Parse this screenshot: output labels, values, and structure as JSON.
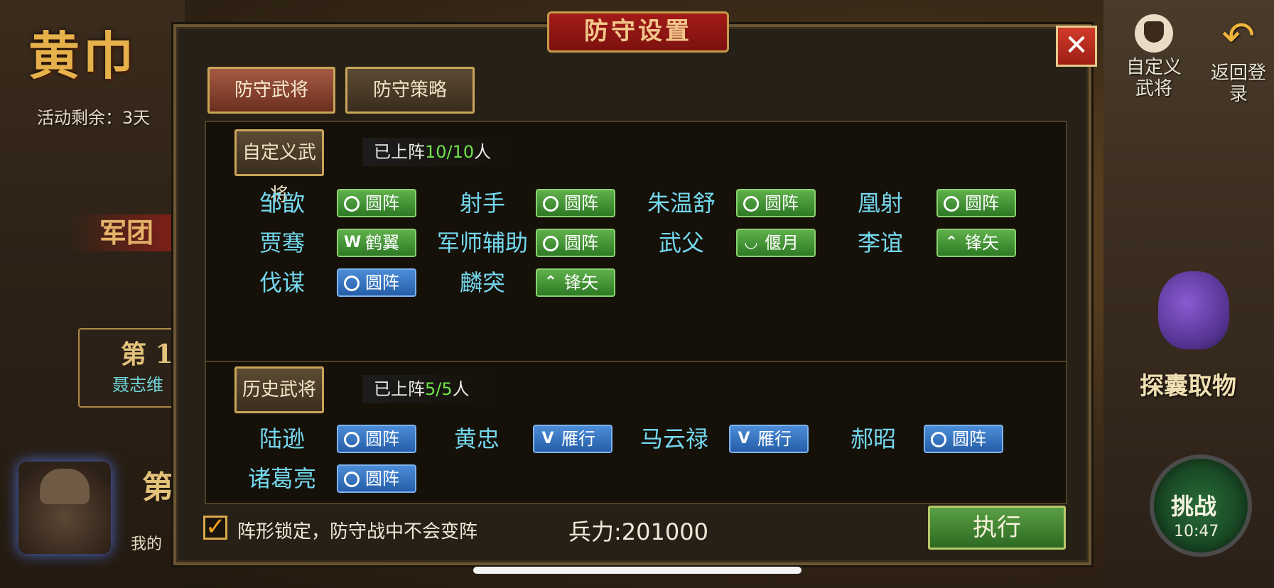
{
  "background": {
    "event_title": "黄巾",
    "event_remaining": "活动剩余：3天",
    "legion_label": "军团",
    "stage_title": "第 1",
    "stage_sub": "聂志维",
    "stage_ghost": "第",
    "my_label": "我的"
  },
  "right_panel": {
    "custom_label": "自定义武将",
    "return_label": "返回登录",
    "bag_label": "探囊取物",
    "challenge_label": "挑战",
    "challenge_time": "10:47"
  },
  "dialog": {
    "title": "防守设置",
    "close_glyph": "✕",
    "tabs": [
      {
        "label": "防守武将",
        "active": true
      },
      {
        "label": "防守策略",
        "active": false
      }
    ],
    "custom_section": {
      "button_label": "自定义武将",
      "deploy_prefix": "已上阵",
      "deploy_count": "10/10",
      "deploy_suffix": "人",
      "generals": [
        {
          "name": "邹歆",
          "formation": "圆阵",
          "icon": "circle-icon",
          "color": "green"
        },
        {
          "name": "射手",
          "formation": "圆阵",
          "icon": "circle-icon",
          "color": "green"
        },
        {
          "name": "朱温舒",
          "formation": "圆阵",
          "icon": "circle-icon",
          "color": "green"
        },
        {
          "name": "凰射",
          "formation": "圆阵",
          "icon": "circle-icon",
          "color": "green"
        },
        {
          "name": "贾骞",
          "formation": "鹤翼",
          "icon": "w-icon",
          "color": "green"
        },
        {
          "name": "军师辅助",
          "formation": "圆阵",
          "icon": "circle-icon",
          "color": "green"
        },
        {
          "name": "武父",
          "formation": "偃月",
          "icon": "crescent-icon",
          "color": "green"
        },
        {
          "name": "李谊",
          "formation": "锋矢",
          "icon": "chevron-up-icon",
          "color": "green"
        },
        {
          "name": "伐谋",
          "formation": "圆阵",
          "icon": "circle-icon",
          "color": "blue"
        },
        {
          "name": "麟突",
          "formation": "锋矢",
          "icon": "chevron-up-icon",
          "color": "green"
        }
      ]
    },
    "history_section": {
      "button_label": "历史武将",
      "deploy_prefix": "已上阵",
      "deploy_count": "5/5",
      "deploy_suffix": "人",
      "generals": [
        {
          "name": "陆逊",
          "formation": "圆阵",
          "icon": "circle-icon",
          "color": "blue"
        },
        {
          "name": "黄忠",
          "formation": "雁行",
          "icon": "v-icon",
          "color": "blue"
        },
        {
          "name": "马云禄",
          "formation": "雁行",
          "icon": "v-icon",
          "color": "blue"
        },
        {
          "name": "郝昭",
          "formation": "圆阵",
          "icon": "circle-icon",
          "color": "blue"
        },
        {
          "name": "诸葛亮",
          "formation": "圆阵",
          "icon": "circle-icon",
          "color": "blue"
        }
      ]
    },
    "footer": {
      "lock_checked": true,
      "lock_text": "阵形锁定，防守战中不会变阵",
      "power_text": "兵力:201000",
      "execute_label": "执行"
    }
  }
}
